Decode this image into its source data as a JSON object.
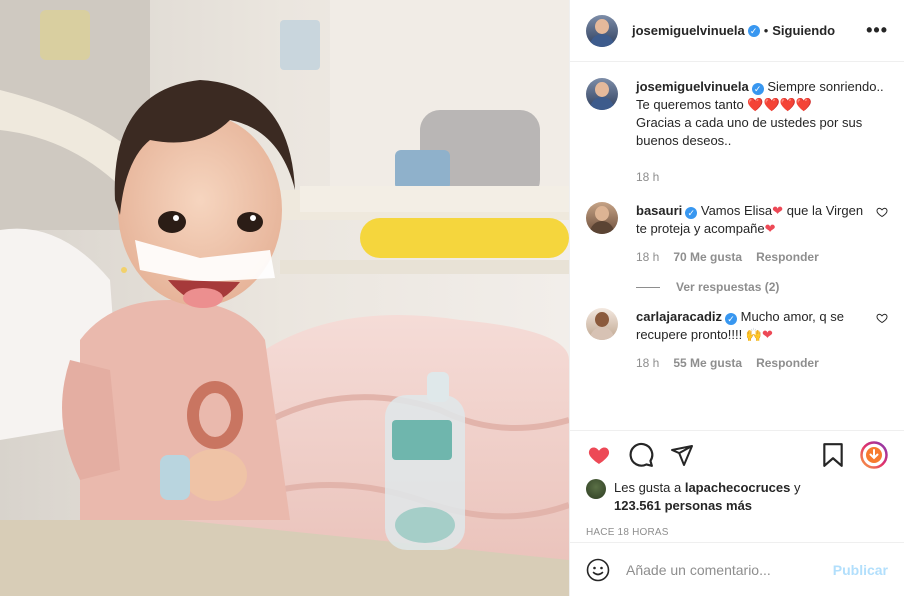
{
  "header": {
    "username": "josemiguelvinuela",
    "separator": "•",
    "follow_status": "Siguiendo",
    "more_icon": "more-horizontal-icon"
  },
  "caption": {
    "username": "josemiguelvinuela",
    "line1": "Siempre sonriendo..",
    "line2": "Te queremos tanto",
    "hearts": "❤️❤️❤️❤️",
    "line3": "Gracias a cada uno de ustedes por sus buenos deseos..",
    "time": "18 h"
  },
  "comments": [
    {
      "username": "basauri",
      "text_a": "Vamos Elisa",
      "heart": "❤",
      "text_b": "que la Virgen te proteja y acompañe",
      "heart_end": "❤",
      "time": "18 h",
      "likes": "70 Me gusta",
      "reply": "Responder"
    },
    {
      "username": "carlajaracadiz",
      "text_a": "Mucho amor, q se recupere pronto!!!!",
      "emoji": "🙌",
      "heart_end": "❤",
      "time": "18 h",
      "likes": "55 Me gusta",
      "reply": "Responder"
    }
  ],
  "replies_toggle": "Ver respuestas (2)",
  "likes": {
    "prefix": "Les gusta a",
    "user": "lapachecocruces",
    "and": "y",
    "count": "123.561 personas más"
  },
  "timestamp": "HACE 18 HORAS",
  "composer": {
    "placeholder": "Añade un comentario...",
    "publish": "Publicar"
  },
  "colors": {
    "like_red": "#ed4956",
    "verified_blue": "#3897f0",
    "publish_disabled": "#b2dffc"
  }
}
